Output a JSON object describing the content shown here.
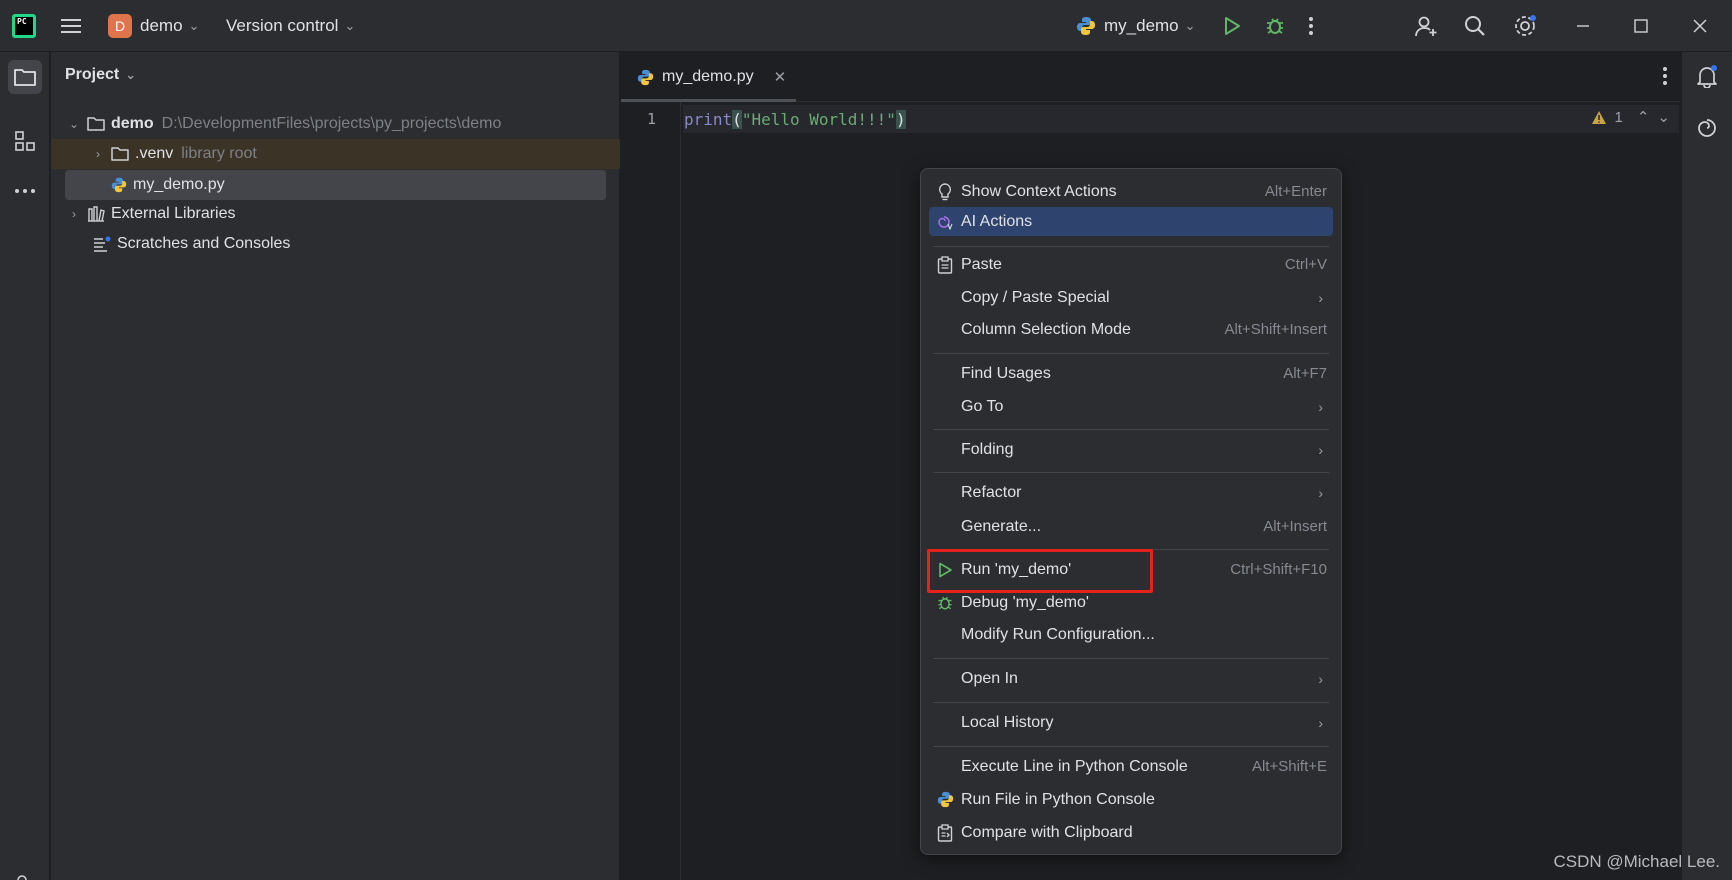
{
  "titlebar": {
    "logo_text": "PC",
    "project_badge": "D",
    "project_name": "demo",
    "vcs_label": "Version control",
    "run_config": "my_demo"
  },
  "project_panel": {
    "header": "Project",
    "tree": {
      "root_name": "demo",
      "root_path": "D:\\DevelopmentFiles\\projects\\py_projects\\demo",
      "venv_name": ".venv",
      "venv_hint": "library root",
      "file_name": "my_demo.py",
      "ext_libs": "External Libraries",
      "scratches": "Scratches and Consoles"
    }
  },
  "editor": {
    "tab_name": "my_demo.py",
    "line_number": "1",
    "code_fn": "print",
    "code_open": "(",
    "code_string": "\"Hello World!!!\"",
    "code_close": ")",
    "warning_count": "1"
  },
  "context_menu": {
    "show_context": {
      "label": "Show Context Actions",
      "shortcut": "Alt+Enter"
    },
    "ai_actions": {
      "label": "AI Actions"
    },
    "paste": {
      "label": "Paste",
      "shortcut": "Ctrl+V"
    },
    "copy_paste_special": {
      "label": "Copy / Paste Special"
    },
    "column_selection": {
      "label": "Column Selection Mode",
      "shortcut": "Alt+Shift+Insert"
    },
    "find_usages": {
      "label": "Find Usages",
      "shortcut": "Alt+F7"
    },
    "go_to": {
      "label": "Go To"
    },
    "folding": {
      "label": "Folding"
    },
    "refactor": {
      "label": "Refactor"
    },
    "generate": {
      "label": "Generate...",
      "shortcut": "Alt+Insert"
    },
    "run": {
      "label": "Run 'my_demo'",
      "shortcut": "Ctrl+Shift+F10"
    },
    "debug": {
      "label": "Debug 'my_demo'"
    },
    "modify_run": {
      "label": "Modify Run Configuration..."
    },
    "open_in": {
      "label": "Open In"
    },
    "local_history": {
      "label": "Local History"
    },
    "execute_line": {
      "label": "Execute Line in Python Console",
      "shortcut": "Alt+Shift+E"
    },
    "run_file_console": {
      "label": "Run File in Python Console"
    },
    "compare_clipboard": {
      "label": "Compare with Clipboard"
    }
  },
  "watermark": "CSDN @Michael Lee.",
  "colors": {
    "accent_highlight": "#2e436e",
    "run_green": "#5fb865",
    "annotation_red": "#e5231d"
  }
}
